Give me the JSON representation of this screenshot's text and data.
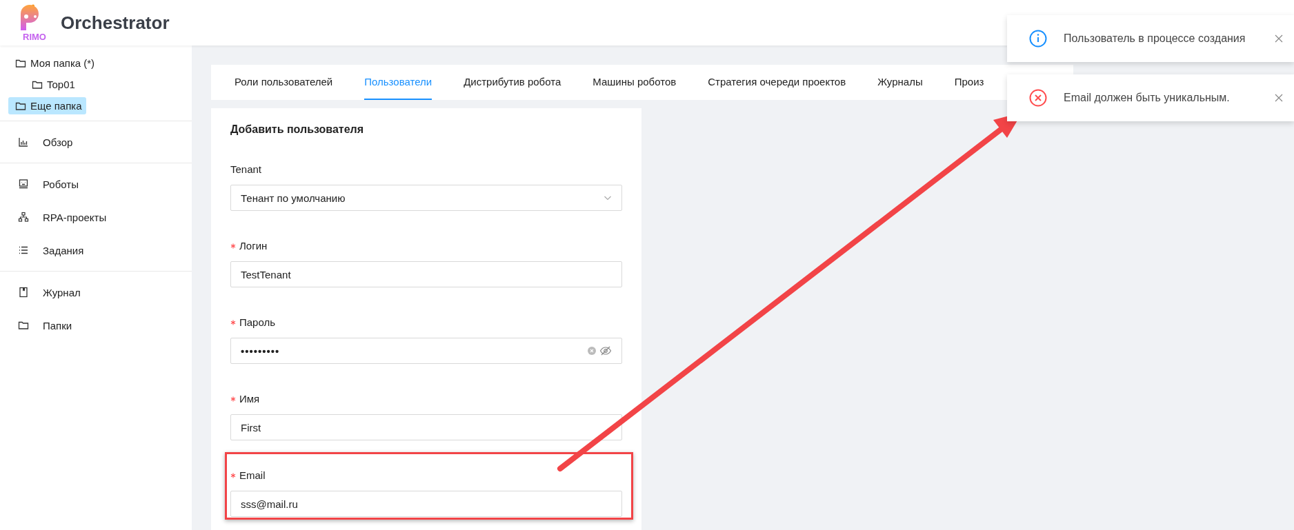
{
  "header": {
    "logo_text": "RIMO",
    "title": "Orchestrator"
  },
  "sidebar": {
    "folders": [
      {
        "label": "Моя папка (*)",
        "selected": false,
        "children": [
          {
            "label": "Top01",
            "selected": false
          }
        ]
      },
      {
        "label": "Еще папка",
        "selected": true
      }
    ],
    "sections": [
      [
        {
          "label": "Обзор"
        }
      ],
      [
        {
          "label": "Роботы"
        },
        {
          "label": "RPA-проекты"
        },
        {
          "label": "Задания"
        }
      ],
      [
        {
          "label": "Журнал"
        },
        {
          "label": "Папки"
        }
      ]
    ]
  },
  "tabs": [
    {
      "label": "Роли пользователей",
      "selected": false
    },
    {
      "label": "Пользователи",
      "selected": true
    },
    {
      "label": "Дистрибутив робота",
      "selected": false
    },
    {
      "label": "Машины роботов",
      "selected": false
    },
    {
      "label": "Стратегия очереди проектов",
      "selected": false
    },
    {
      "label": "Журналы",
      "selected": false
    },
    {
      "label": "Произ",
      "selected": false
    }
  ],
  "form": {
    "title": "Добавить пользователя",
    "fields": [
      {
        "kind": "select",
        "label": "Tenant",
        "required": false,
        "value": "Тенант по умолчанию"
      },
      {
        "kind": "text",
        "label": "Логин",
        "required": true,
        "value": "TestTenant"
      },
      {
        "kind": "password",
        "label": "Пароль",
        "required": true,
        "value": "•••••••••"
      },
      {
        "kind": "text",
        "label": "Имя",
        "required": true,
        "value": "First"
      },
      {
        "kind": "text",
        "label": "Email",
        "required": true,
        "value": "sss@mail.ru"
      }
    ]
  },
  "notifications": [
    {
      "kind": "info",
      "message": "Пользователь в процессе создания"
    },
    {
      "kind": "error",
      "message": "Email должен быть уникальным."
    }
  ]
}
